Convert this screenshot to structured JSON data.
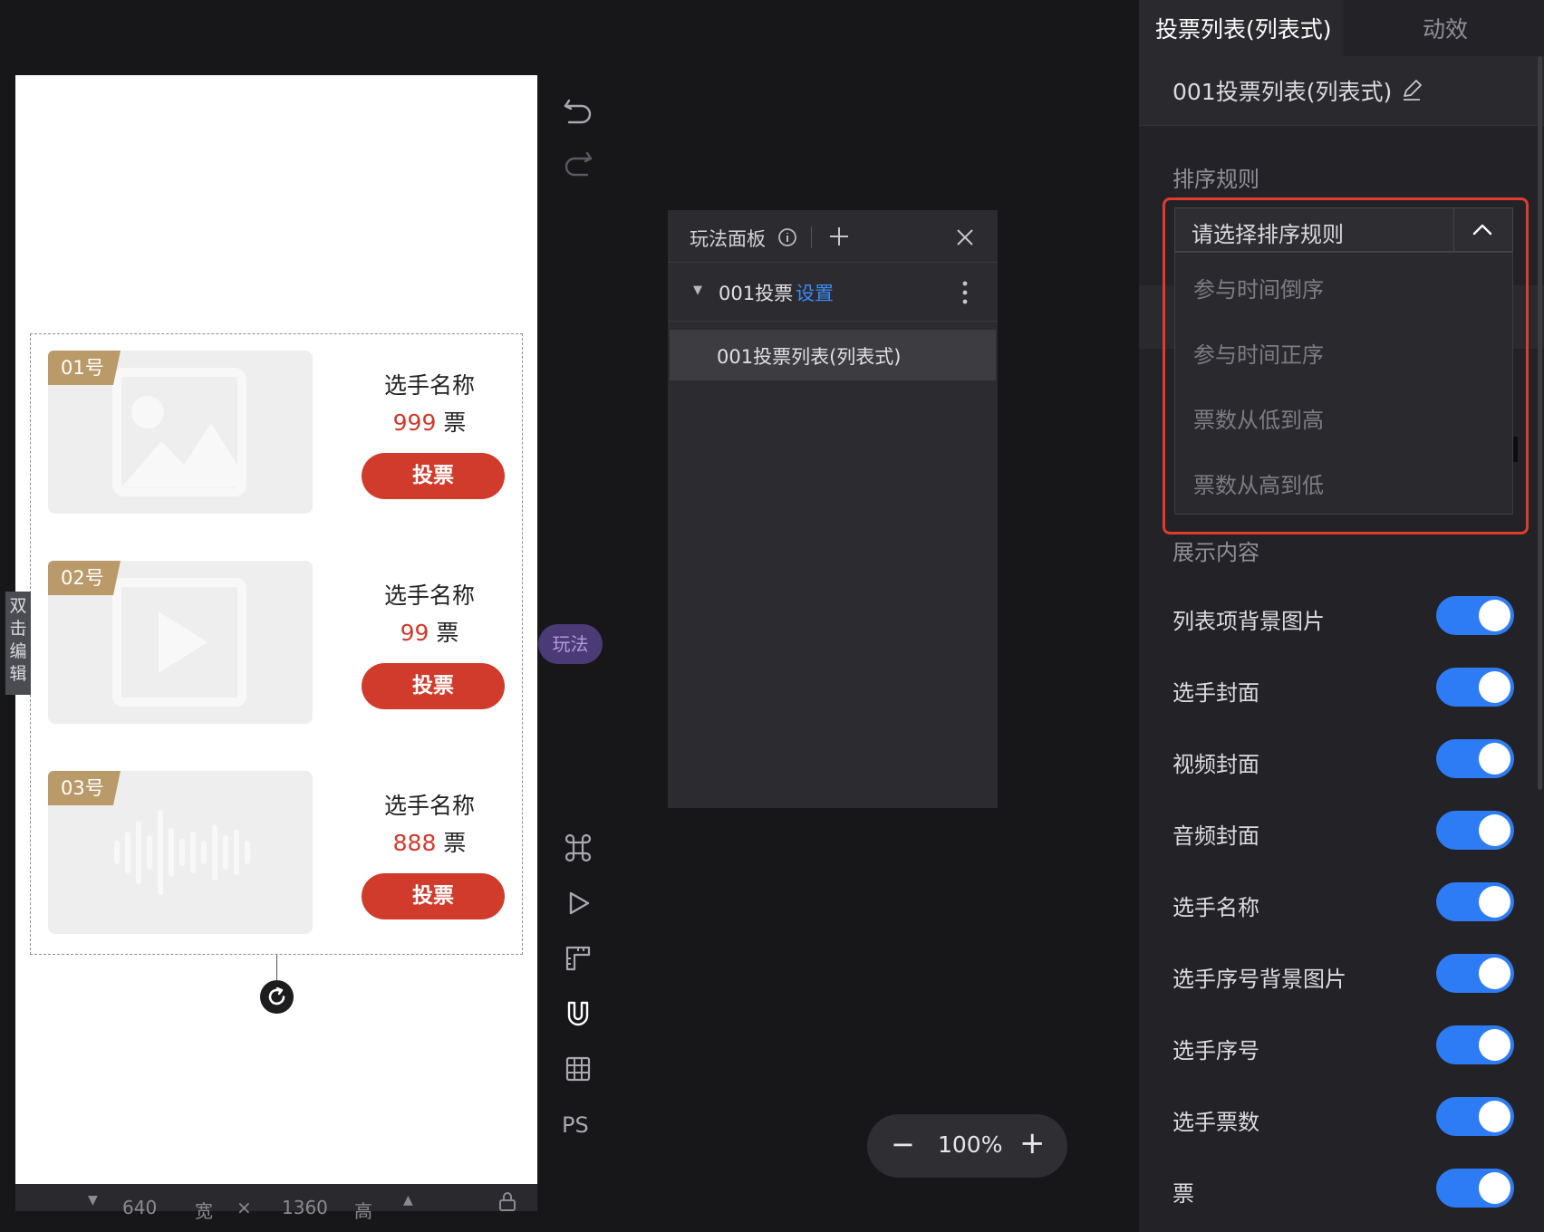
{
  "canvas": {
    "double_click_edit": "双击编辑",
    "candidates": [
      {
        "badge": "01号",
        "name": "选手名称",
        "votes": "999",
        "unit": "票",
        "vote_label": "投票",
        "cover": "image-icon"
      },
      {
        "badge": "02号",
        "name": "选手名称",
        "votes": "99",
        "unit": "票",
        "vote_label": "投票",
        "cover": "video-icon"
      },
      {
        "badge": "03号",
        "name": "选手名称",
        "votes": "888",
        "unit": "票",
        "vote_label": "投票",
        "cover": "audio-icon"
      }
    ],
    "size_bar": {
      "width": "640",
      "width_unit": "宽",
      "times": "×",
      "height": "1360",
      "height_unit": "高"
    }
  },
  "tools": {
    "play_tag": "玩法",
    "ps_label": "PS",
    "icons": [
      "undo-icon",
      "redo-icon",
      "command-icon",
      "play-icon",
      "ruler-icon",
      "magnet-icon",
      "grid-icon"
    ]
  },
  "play_panel": {
    "title": "玩法面板",
    "group_name": "001投票",
    "group_setting": "设置",
    "item": "001投票列表(列表式)"
  },
  "zoom": {
    "value": "100%",
    "minus": "−",
    "plus": "+"
  },
  "right_panel": {
    "tabs": [
      {
        "label": "投票列表(列表式)"
      },
      {
        "label": "动效"
      }
    ],
    "component_name": "001投票列表(列表式)",
    "sort_label": "排序规则",
    "dropdown": {
      "placeholder": "请选择排序规则",
      "options": [
        "参与时间倒序",
        "参与时间正序",
        "票数从低到高",
        "票数从高到低"
      ]
    },
    "display_label": "展示内容",
    "toggles": [
      {
        "label": "列表项背景图片",
        "on": true
      },
      {
        "label": "选手封面",
        "on": true
      },
      {
        "label": "视频封面",
        "on": true
      },
      {
        "label": "音频封面",
        "on": true
      },
      {
        "label": "选手名称",
        "on": true
      },
      {
        "label": "选手序号背景图片",
        "on": true
      },
      {
        "label": "选手序号",
        "on": true
      },
      {
        "label": "选手票数",
        "on": true
      },
      {
        "label": "票",
        "on": true
      }
    ]
  },
  "colors": {
    "accent": "#2d7cf6",
    "vote_red": "#d13b2b",
    "badge_gold": "#b99a68",
    "highlight_outline": "#e03b2e"
  }
}
